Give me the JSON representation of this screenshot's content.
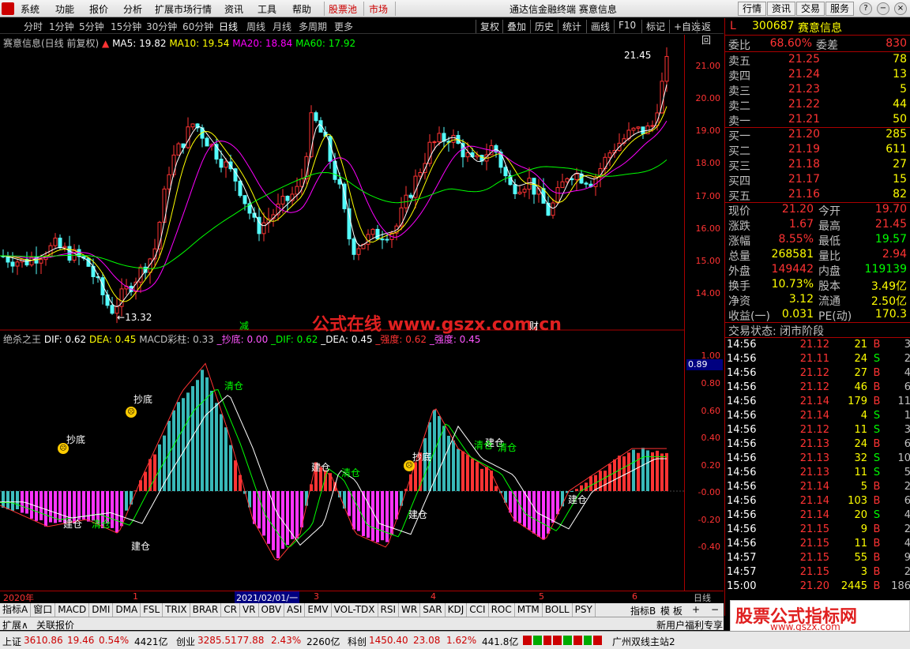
{
  "menu": {
    "items": [
      "系统",
      "功能",
      "报价",
      "分析",
      "扩展市场行情",
      "资讯",
      "工具",
      "帮助"
    ],
    "stockpool": "股票池",
    "market": "市场",
    "title": "通达信金融终端 赛意信息",
    "right_buttons": [
      "行情",
      "资讯",
      "交易",
      "服务"
    ]
  },
  "toolbar": {
    "periods": [
      "分时",
      "1分钟",
      "5分钟",
      "15分钟",
      "30分钟",
      "60分钟",
      "日线",
      "周线",
      "月线",
      "多周期",
      "更多"
    ],
    "active": "日线",
    "tools": [
      "复权",
      "叠加",
      "历史",
      "统计",
      "画线",
      "F10",
      "标记",
      "+自选",
      "返回"
    ]
  },
  "kline": {
    "name": "赛意信息(日线 前复权)",
    "ma5": "MA5: 19.82",
    "ma10": "MA10: 19.54",
    "ma20": "MA20: 18.84",
    "ma60": "MA60: 17.92",
    "high_label": "21.45",
    "low_label": "13.32",
    "y_ticks": [
      "21.00",
      "20.00",
      "19.00",
      "18.00",
      "17.00",
      "16.00",
      "15.00",
      "14.00"
    ]
  },
  "indicator": {
    "name": "绝杀之王",
    "dif": "DIF: 0.62",
    "dea": "DEA: 0.45",
    "macd": "MACD彩柱: 0.33",
    "chaodi": "_抄底: 0.00",
    "dif2": "_DIF: 0.62",
    "dea2": "_DEA: 0.45",
    "qiang1": "_强度: 0.62",
    "qiang2": "_强度: 0.45",
    "current": "0.89",
    "y_ticks": [
      "1.00",
      "0.80",
      "0.60",
      "0.40",
      "0.20",
      "-0.00",
      "-0.20",
      "-0.40"
    ],
    "labels": {
      "chaodi": "抄底",
      "jiancang": "建仓",
      "qingcang": "清仓"
    },
    "jian": "减",
    "cai": "财"
  },
  "watermark": {
    "site": "公式在线 www.gszx.com.cn",
    "logo1": "股票公式指标网",
    "logo2": "www.gszx.com"
  },
  "timeaxis": {
    "labels": [
      "2020年",
      "1",
      "2021/02/01/一",
      "3",
      "4",
      "5",
      "6"
    ],
    "period": "日线"
  },
  "tabs": {
    "items": [
      "指标A",
      "窗口",
      "MACD",
      "DMI",
      "DMA",
      "FSL",
      "TRIX",
      "BRAR",
      "CR",
      "VR",
      "OBV",
      "ASI",
      "EMV",
      "VOL-TDX",
      "RSI",
      "WR",
      "SAR",
      "KDJ",
      "CCI",
      "ROC",
      "MTM",
      "BOLL",
      "PSY"
    ],
    "right": [
      "指标B",
      "模 板",
      "+",
      "−"
    ],
    "row2": [
      "扩展∧",
      "关联报价"
    ],
    "promo": "新用户福利专享"
  },
  "status": {
    "sh_name": "上证",
    "sh_val": "3610.86",
    "sh_chg": "19.46",
    "sh_pct": "0.54%",
    "sh_amt": "4421亿",
    "cy_name": "创业",
    "cy_val": "3285.51",
    "cy_chg": "77.88",
    "cy_pct": "2.43%",
    "cy_amt": "2260亿",
    "kc_name": "科创",
    "kc_val": "1450.40",
    "kc_chg": "23.08",
    "kc_pct": "1.62%",
    "kc_amt": "441.8亿",
    "station": "广州双线主站2"
  },
  "quote": {
    "flag": "L",
    "code": "300687",
    "name": "赛意信息",
    "weibi_label": "委比",
    "weibi": "68.60%",
    "weicha_label": "委差",
    "weicha": "830",
    "asks": [
      {
        "label": "卖五",
        "price": "21.25",
        "vol": "78"
      },
      {
        "label": "卖四",
        "price": "21.24",
        "vol": "13"
      },
      {
        "label": "卖三",
        "price": "21.23",
        "vol": "5"
      },
      {
        "label": "卖二",
        "price": "21.22",
        "vol": "44"
      },
      {
        "label": "卖一",
        "price": "21.21",
        "vol": "50"
      }
    ],
    "bids": [
      {
        "label": "买一",
        "price": "21.20",
        "vol": "285"
      },
      {
        "label": "买二",
        "price": "21.19",
        "vol": "611"
      },
      {
        "label": "买三",
        "price": "21.18",
        "vol": "27"
      },
      {
        "label": "买四",
        "price": "21.17",
        "vol": "15"
      },
      {
        "label": "买五",
        "price": "21.16",
        "vol": "82"
      }
    ],
    "stats": [
      {
        "l1": "现价",
        "v1": "21.20",
        "l2": "今开",
        "v2": "19.70"
      },
      {
        "l1": "涨跌",
        "v1": "1.67",
        "l2": "最高",
        "v2": "21.45"
      },
      {
        "l1": "涨幅",
        "v1": "8.55%",
        "l2": "最低",
        "v2": "19.57"
      },
      {
        "l1": "总量",
        "v1": "268581",
        "l2": "量比",
        "v2": "2.94"
      },
      {
        "l1": "外盘",
        "v1": "149442",
        "l2": "内盘",
        "v2": "119139"
      },
      {
        "l1": "换手",
        "v1": "10.73%",
        "l2": "股本",
        "v2": "3.49亿"
      },
      {
        "l1": "净资",
        "v1": "3.12",
        "l2": "流通",
        "v2": "2.50亿"
      },
      {
        "l1": "收益(一)",
        "v1": "0.031",
        "l2": "PE(动)",
        "v2": "170.3"
      }
    ],
    "trade_status": "交易状态: 闭市阶段",
    "ticks": [
      {
        "t": "14:56",
        "p": "21.12",
        "v": "21",
        "s": "B",
        "n": "3"
      },
      {
        "t": "14:56",
        "p": "21.11",
        "v": "24",
        "s": "S",
        "n": "2"
      },
      {
        "t": "14:56",
        "p": "21.12",
        "v": "27",
        "s": "B",
        "n": "4"
      },
      {
        "t": "14:56",
        "p": "21.12",
        "v": "46",
        "s": "B",
        "n": "6"
      },
      {
        "t": "14:56",
        "p": "21.14",
        "v": "179",
        "s": "B",
        "n": "11"
      },
      {
        "t": "14:56",
        "p": "21.14",
        "v": "4",
        "s": "S",
        "n": "1"
      },
      {
        "t": "14:56",
        "p": "21.12",
        "v": "11",
        "s": "S",
        "n": "3"
      },
      {
        "t": "14:56",
        "p": "21.13",
        "v": "24",
        "s": "B",
        "n": "6"
      },
      {
        "t": "14:56",
        "p": "21.13",
        "v": "32",
        "s": "S",
        "n": "10"
      },
      {
        "t": "14:56",
        "p": "21.13",
        "v": "11",
        "s": "S",
        "n": "5"
      },
      {
        "t": "14:56",
        "p": "21.14",
        "v": "5",
        "s": "B",
        "n": "2"
      },
      {
        "t": "14:56",
        "p": "21.14",
        "v": "103",
        "s": "B",
        "n": "6"
      },
      {
        "t": "14:56",
        "p": "21.14",
        "v": "20",
        "s": "S",
        "n": "4"
      },
      {
        "t": "14:56",
        "p": "21.15",
        "v": "9",
        "s": "B",
        "n": "2"
      },
      {
        "t": "14:56",
        "p": "21.15",
        "v": "11",
        "s": "B",
        "n": "4"
      },
      {
        "t": "14:57",
        "p": "21.15",
        "v": "55",
        "s": "B",
        "n": "9"
      },
      {
        "t": "14:57",
        "p": "21.15",
        "v": "3",
        "s": "B",
        "n": "2"
      },
      {
        "t": "15:00",
        "p": "21.20",
        "v": "2445",
        "s": "B",
        "n": "186"
      }
    ]
  },
  "chart_data": {
    "type": "candlestick",
    "price_range": [
      13.32,
      21.45
    ],
    "last_close": 21.2,
    "ma": {
      "ma5": 19.82,
      "ma10": 19.54,
      "ma20": 18.84,
      "ma60": 17.92
    },
    "indicator_range": [
      -0.5,
      1.0
    ],
    "dif": 0.62,
    "dea": 0.45,
    "macd": 0.33
  }
}
